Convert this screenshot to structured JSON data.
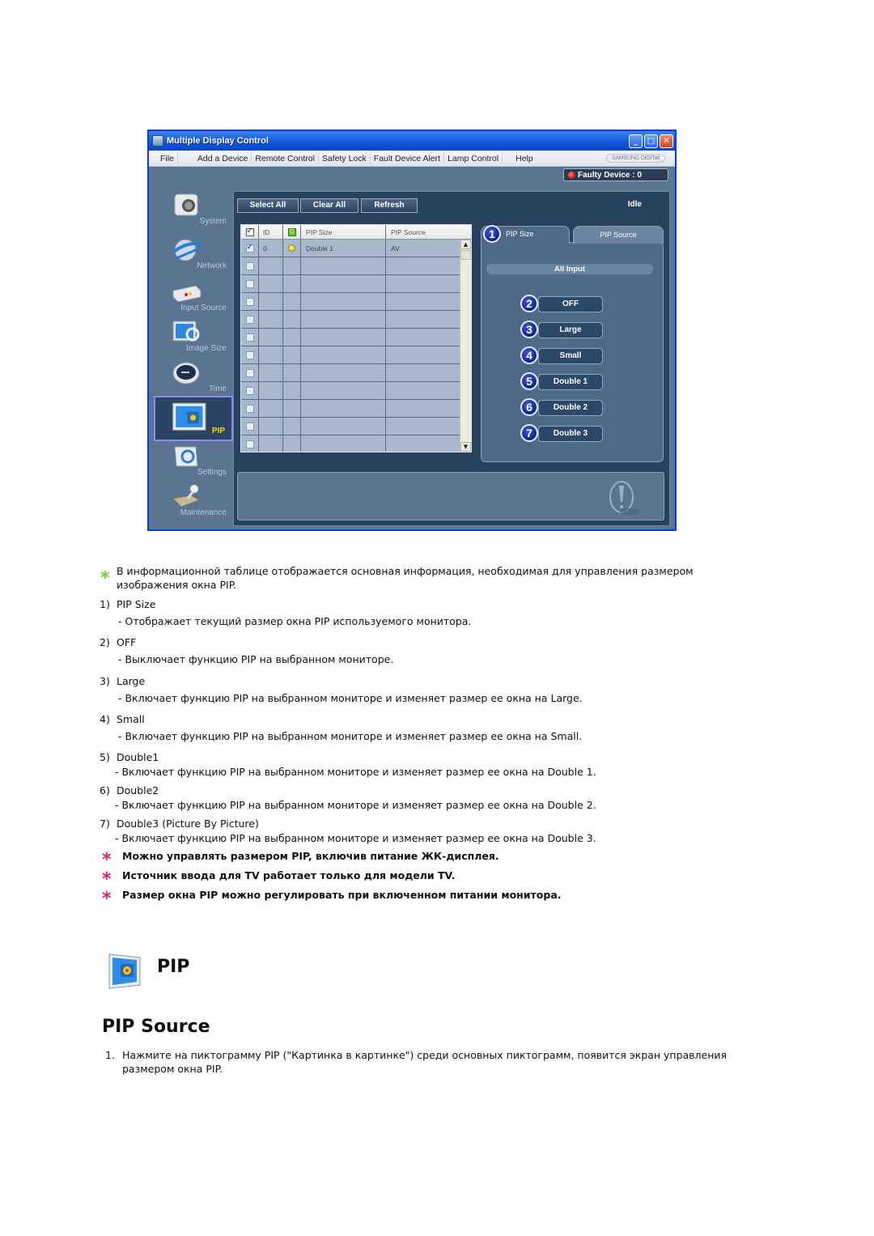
{
  "window": {
    "title": "Multiple Display Control",
    "menu": [
      "File",
      "Add a Device",
      "Remote Control",
      "Safety Lock",
      "Fault Device Alert",
      "Lamp Control",
      "Help"
    ],
    "brand": "SAMSUNG DIGITall",
    "faulty_device": "Faulty Device : 0",
    "status": "Idle",
    "toolbar": {
      "select_all": "Select All",
      "clear_all": "Clear All",
      "refresh": "Refresh"
    },
    "sidebar": [
      {
        "label": "System",
        "icon": "camera-icon"
      },
      {
        "label": "Network",
        "icon": "globe-icon"
      },
      {
        "label": "Input Source",
        "icon": "input-device-icon"
      },
      {
        "label": "Image Size",
        "icon": "monitor-magnifier-icon"
      },
      {
        "label": "Time",
        "icon": "clock-icon"
      },
      {
        "label": "PIP",
        "icon": "pip-monitor-icon",
        "active": true
      },
      {
        "label": "Settings",
        "icon": "settings-box-icon"
      },
      {
        "label": "Maintenance",
        "icon": "maintenance-icon"
      }
    ],
    "table": {
      "headers": [
        "",
        "ID",
        "",
        "PIP Size",
        "PIP Source"
      ],
      "rows": [
        {
          "checked": true,
          "id": "0",
          "power": "on",
          "pip_size": "Double 1",
          "pip_source": "AV"
        },
        {
          "checked": false,
          "id": "",
          "power": "",
          "pip_size": "",
          "pip_source": ""
        },
        {
          "checked": false,
          "id": "",
          "power": "",
          "pip_size": "",
          "pip_source": ""
        },
        {
          "checked": false,
          "id": "",
          "power": "",
          "pip_size": "",
          "pip_source": ""
        },
        {
          "checked": false,
          "id": "",
          "power": "",
          "pip_size": "",
          "pip_source": ""
        },
        {
          "checked": false,
          "id": "",
          "power": "",
          "pip_size": "",
          "pip_source": ""
        },
        {
          "checked": false,
          "id": "",
          "power": "",
          "pip_size": "",
          "pip_source": ""
        },
        {
          "checked": false,
          "id": "",
          "power": "",
          "pip_size": "",
          "pip_source": ""
        },
        {
          "checked": false,
          "id": "",
          "power": "",
          "pip_size": "",
          "pip_source": ""
        },
        {
          "checked": false,
          "id": "",
          "power": "",
          "pip_size": "",
          "pip_source": ""
        },
        {
          "checked": false,
          "id": "",
          "power": "",
          "pip_size": "",
          "pip_source": ""
        },
        {
          "checked": false,
          "id": "",
          "power": "",
          "pip_size": "",
          "pip_source": ""
        }
      ]
    },
    "tabs": [
      {
        "label": "PIP Size",
        "badge": "1",
        "active": true
      },
      {
        "label": "PIP Source"
      }
    ],
    "all_input": "All Input",
    "size_buttons": [
      {
        "badge": "2",
        "label": "OFF"
      },
      {
        "badge": "3",
        "label": "Large"
      },
      {
        "badge": "4",
        "label": "Small"
      },
      {
        "badge": "5",
        "label": "Double 1"
      },
      {
        "badge": "6",
        "label": "Double 2"
      },
      {
        "badge": "7",
        "label": "Double 3"
      }
    ]
  },
  "doc": {
    "intro_line1": "В информационной таблице отображается основная информация, необходимая для управления размером",
    "intro_line2": "изображения окна PIP.",
    "items": [
      {
        "num": "1)",
        "title": "PIP Size",
        "desc": "- Отображает текущий размер окна PIP используемого монитора."
      },
      {
        "num": "2)",
        "title": "OFF",
        "desc": "- Выключает функцию PIP на выбранном мониторе."
      },
      {
        "num": "3)",
        "title": "Large",
        "desc": "- Включает функцию PIP на выбранном мониторе и изменяет размер ее окна на Large."
      },
      {
        "num": "4)",
        "title": "Small",
        "desc": "- Включает функцию PIP на выбранном мониторе и изменяет размер ее окна на Small."
      },
      {
        "num": "5)",
        "title": "Double1",
        "desc": "- Включает функцию PIP на выбранном мониторе и изменяет размер ее окна на Double 1."
      },
      {
        "num": "6)",
        "title": "Double2",
        "desc": "- Включает функцию PIP на выбранном мониторе и изменяет размер ее окна на Double 2."
      },
      {
        "num": "7)",
        "title": "Double3 (Picture By Picture)",
        "desc": "- Включает функцию PIP на выбранном мониторе и изменяет размер ее окна на Double 3."
      }
    ],
    "notes": [
      "Можно управлять размером PIP, включив питание ЖК-дисплея.",
      "Источник ввода для TV работает только для модели TV.",
      "Размер окна PIP можно регулировать при включенном питании монитора."
    ],
    "section_title": "PIP",
    "subsection_title": "PIP Source",
    "step1_num": "1.",
    "step1_line1": "Нажмите на пиктограмму PIP (\"Картинка в картинке\") среди основных пиктограмм, появится экран управления",
    "step1_line2": "размером окна PIP.",
    "colors": {
      "note_star": "#e0215a",
      "intro_star": "#7dc33a",
      "title_bar": "#0f56d8"
    }
  }
}
